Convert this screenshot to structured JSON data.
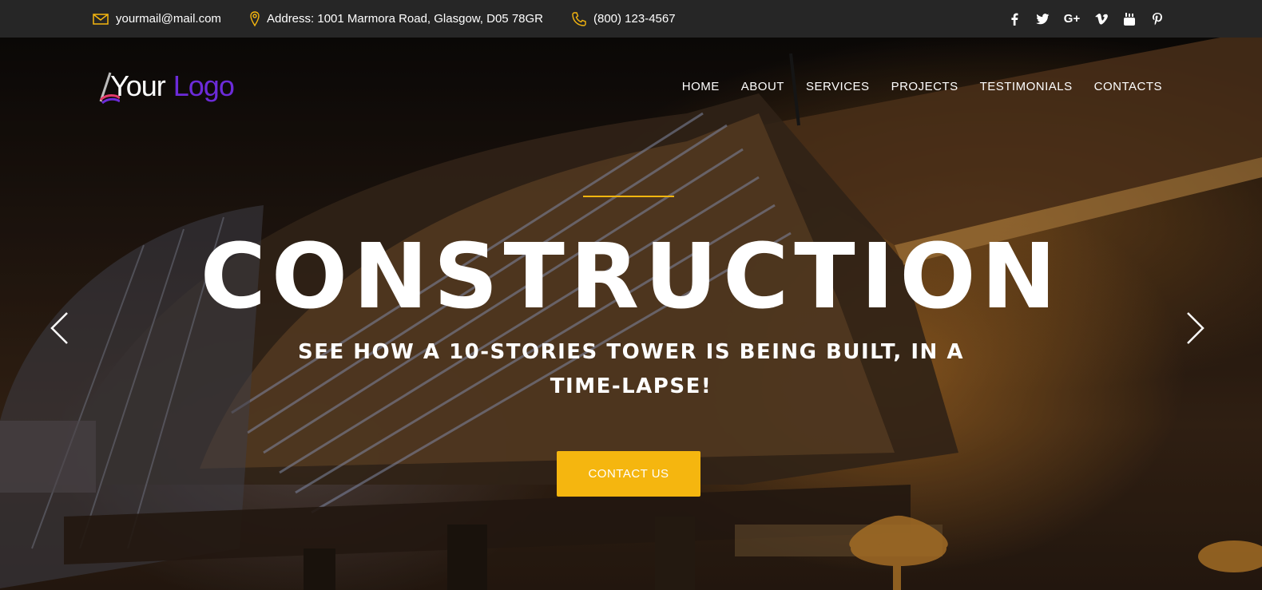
{
  "topbar": {
    "email": "yourmail@mail.com",
    "address": "Address: 1001 Marmora Road, Glasgow, D05 78GR",
    "phone": "(800) 123-4567",
    "socials": [
      "facebook-icon",
      "twitter-icon",
      "google-plus-icon",
      "vimeo-icon",
      "youtube-icon",
      "pinterest-icon"
    ],
    "google_plus_text": "G+"
  },
  "logo": {
    "part1": "Your",
    "part2": "Logo"
  },
  "nav": {
    "items": [
      {
        "label": "HOME"
      },
      {
        "label": "ABOUT"
      },
      {
        "label": "SERVICES"
      },
      {
        "label": "PROJECTS"
      },
      {
        "label": "TESTIMONIALS"
      },
      {
        "label": "CONTACTS"
      }
    ]
  },
  "hero": {
    "title": "CONSTRUCTION",
    "subtitle": "SEE HOW A 10-STORIES TOWER IS BEING BUILT, IN A TIME-LAPSE!",
    "cta_label": "CONTACT US"
  },
  "colors": {
    "accent": "#f5b60f",
    "topbar_bg": "#262626",
    "logo_purple": "#6c2bd9"
  }
}
